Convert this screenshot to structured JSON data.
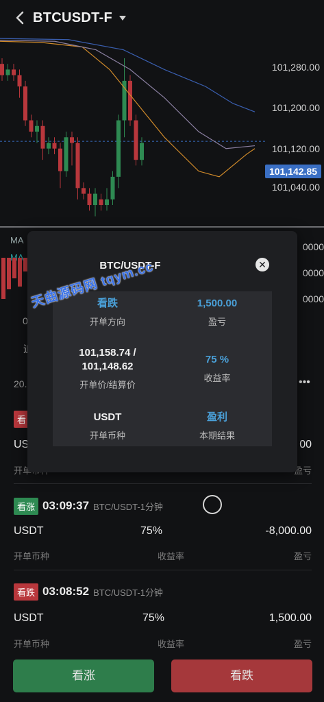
{
  "header": {
    "title": "BTCUSDT-F"
  },
  "chart": {
    "price_levels": [
      "101,280.00",
      "101,200.00",
      "101,120.00",
      "101,040.00"
    ],
    "current_price": "101,142.85",
    "colors": {
      "up": "#2e8a52",
      "down": "#b8373c",
      "ma1": "#d08a2a",
      "ma2": "#8a7fa0",
      "ma3": "#3a5fb0"
    }
  },
  "sub_panel": {
    "ma_labels": [
      "MA",
      "MA"
    ],
    "values": [
      "0000",
      "0000",
      "0000"
    ]
  },
  "obscured_row": {
    "left_text": "20.",
    "more": "•••",
    "misc1": "0",
    "misc2": "追"
  },
  "orders": [
    {
      "badge": "看",
      "badge_color": "red",
      "time": "",
      "pair": "",
      "currency": "USDT",
      "rate": "",
      "pnl": "00",
      "label_currency": "开单币种",
      "label_rate": "",
      "label_pnl": "盈亏"
    },
    {
      "badge": "看涨",
      "badge_color": "green",
      "time": "03:09:37",
      "pair": "BTC/USDT-1分钟",
      "currency": "USDT",
      "rate": "75%",
      "pnl": "-8,000.00",
      "label_currency": "开单币种",
      "label_rate": "收益率",
      "label_pnl": "盈亏"
    },
    {
      "badge": "看跌",
      "badge_color": "red",
      "time": "03:08:52",
      "pair": "BTC/USDT-1分钟",
      "currency": "USDT",
      "rate": "75%",
      "pnl": "1,500.00",
      "label_currency": "开单币种",
      "label_rate": "收益率",
      "label_pnl": "盈亏"
    }
  ],
  "buttons": {
    "up": "看涨",
    "down": "看跌"
  },
  "modal": {
    "title": "BTC/USDT-F",
    "direction_value": "看跌",
    "direction_label": "开单方向",
    "pnl_value": "1,500.00",
    "pnl_label": "盈亏",
    "price_value_1": "101,158.74 /",
    "price_value_2": "101,148.62",
    "price_label": "开单价/结算价",
    "rate_value": "75 %",
    "rate_label": "收益率",
    "currency_value": "USDT",
    "currency_label": "开单币种",
    "result_value": "盈利",
    "result_label": "本期结果"
  },
  "watermark": "天曲源码网 tqym.cc"
}
